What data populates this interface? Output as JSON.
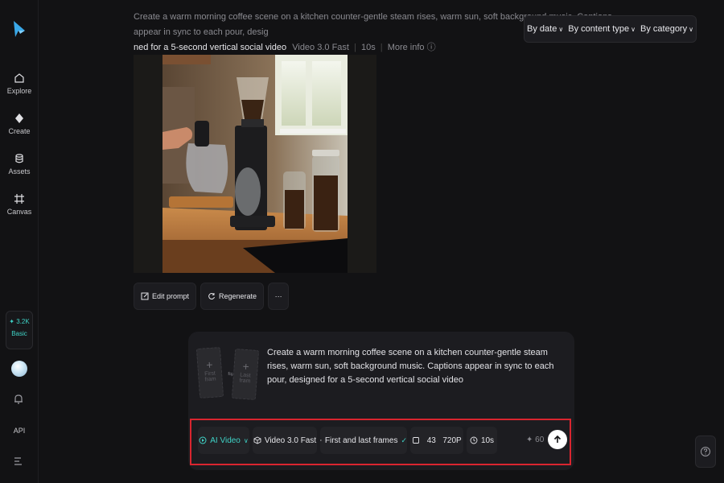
{
  "sidebar": {
    "items": [
      {
        "label": "Explore",
        "icon": "home-icon"
      },
      {
        "label": "Create",
        "icon": "diamond-icon"
      },
      {
        "label": "Assets",
        "icon": "database-icon"
      },
      {
        "label": "Canvas",
        "icon": "grid-icon"
      }
    ],
    "credits": {
      "amount": "✦ 3.2K",
      "plan": "Basic"
    },
    "api_label": "API"
  },
  "history": {
    "prompt_line1": "Create a warm morning coffee scene on a kitchen counter-gentle steam rises, warm sun, soft background music. Captions appear in sync to each pour, desig",
    "prompt_line2": "ned for a 5-second vertical social video",
    "model": "Video 3.0 Fast",
    "duration": "10s",
    "more_info": "More info"
  },
  "filters": {
    "date": "By date",
    "content_type": "By content type",
    "category": "By category"
  },
  "actions": {
    "edit": "Edit prompt",
    "regenerate": "Regenerate",
    "more": "···"
  },
  "composer": {
    "first_frame": "First fram",
    "last_frame": "Last fram",
    "prompt": "Create a warm morning coffee scene on a kitchen counter-gentle steam rises, warm sun, soft background music. Captions appear in sync to each pour, designed for a 5-second vertical social video"
  },
  "toolbar": {
    "mode": "AI Video",
    "model": "Video 3.0 Fast",
    "frames": "First and last frames",
    "ratio": "43",
    "resolution": "720P",
    "duration": "10s",
    "cost": "✦ 60"
  },
  "colors": {
    "accent": "#3fd3c7",
    "highlight": "#d9252f",
    "background": "#121214",
    "panel": "#1c1c20"
  }
}
